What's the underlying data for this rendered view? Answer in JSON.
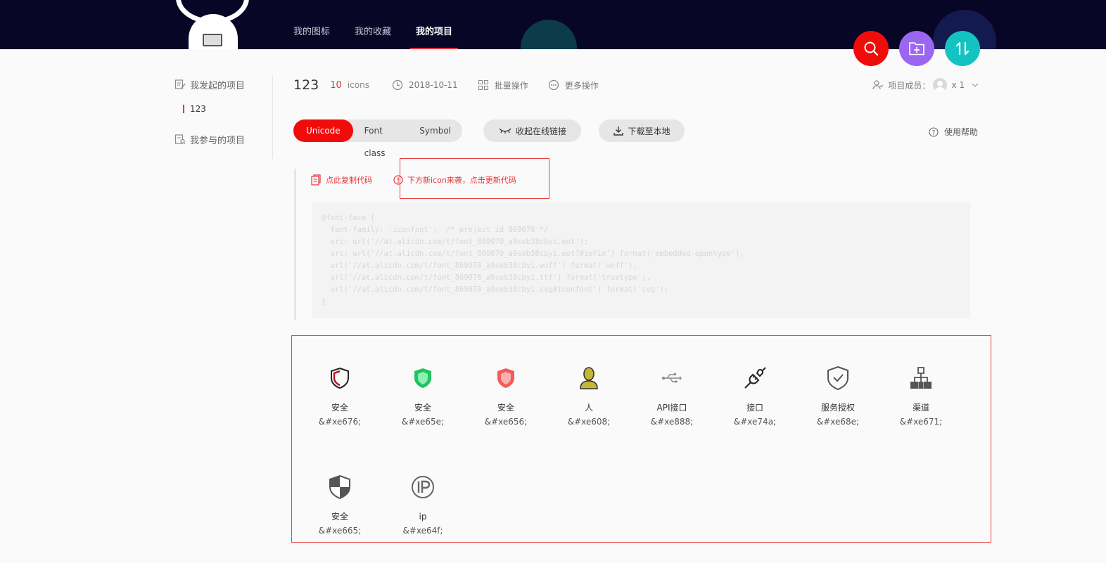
{
  "header": {
    "nav": [
      "我的图标",
      "我的收藏",
      "我的项目"
    ],
    "active_nav": "我的项目"
  },
  "sidebar": {
    "created_label": "我发起的项目",
    "project_item": "123",
    "joined_label": "我参与的项目"
  },
  "project": {
    "name": "123",
    "count": "10",
    "count_unit": "icons",
    "date": "2018-10-11",
    "batch_label": "批量操作",
    "more_label": "更多操作",
    "members_label": "项目成员：",
    "members_count": "x 1"
  },
  "toolbar": {
    "tabs": [
      "Unicode",
      "Font class",
      "Symbol"
    ],
    "active_tab": "Unicode",
    "collapse_label": "收起在线链接",
    "download_label": "下载至本地",
    "help_label": "使用帮助"
  },
  "code_panel": {
    "copy_label": "点此复制代码",
    "update_label": "下方新icon来袭，点击更新代码",
    "code": "@font-face {\n  font-family: 'iconfont';  /* project id 869070 */\n  src: url('//at.alicdn.com/t/font_869070_a9seb38cbyi.eot');\n  src: url('//at.alicdn.com/t/font_869070_a9seb38cbyi.eot?#iefix') format('embedded-opentype'),\n  url('//at.alicdn.com/t/font_869070_a9seb38cbyi.woff') format('woff'),\n  url('//at.alicdn.com/t/font_869070_a9seb38cbyi.ttf') format('truetype'),\n  url('//at.alicdn.com/t/font_869070_a9seb38cbyi.svg#iconfont') format('svg');\n}"
  },
  "icons": [
    {
      "name": "安全",
      "code": "&#xe676;",
      "icon": "shield-outline-icon",
      "color": "#b3121c"
    },
    {
      "name": "安全",
      "code": "&#xe65e;",
      "icon": "shield-green-icon",
      "color": "#20c460"
    },
    {
      "name": "安全",
      "code": "&#xe656;",
      "icon": "shield-red-icon",
      "color": "#f25c5c"
    },
    {
      "name": "人",
      "code": "&#xe608;",
      "icon": "person-icon",
      "color": "#c7b53a"
    },
    {
      "name": "API接口",
      "code": "&#xe888;",
      "icon": "usb-icon",
      "color": "#888888"
    },
    {
      "name": "接口",
      "code": "&#xe74a;",
      "icon": "plug-icon",
      "color": "#333333"
    },
    {
      "name": "服务授权",
      "code": "&#xe68e;",
      "icon": "shield-check-icon",
      "color": "#555555"
    },
    {
      "name": "渠道",
      "code": "&#xe671;",
      "icon": "network-icon",
      "color": "#555555"
    },
    {
      "name": "安全",
      "code": "&#xe665;",
      "icon": "shield-quarter-icon",
      "color": "#555555"
    },
    {
      "name": "ip",
      "code": "&#xe64f;",
      "icon": "ip-icon",
      "color": "#666666"
    }
  ]
}
